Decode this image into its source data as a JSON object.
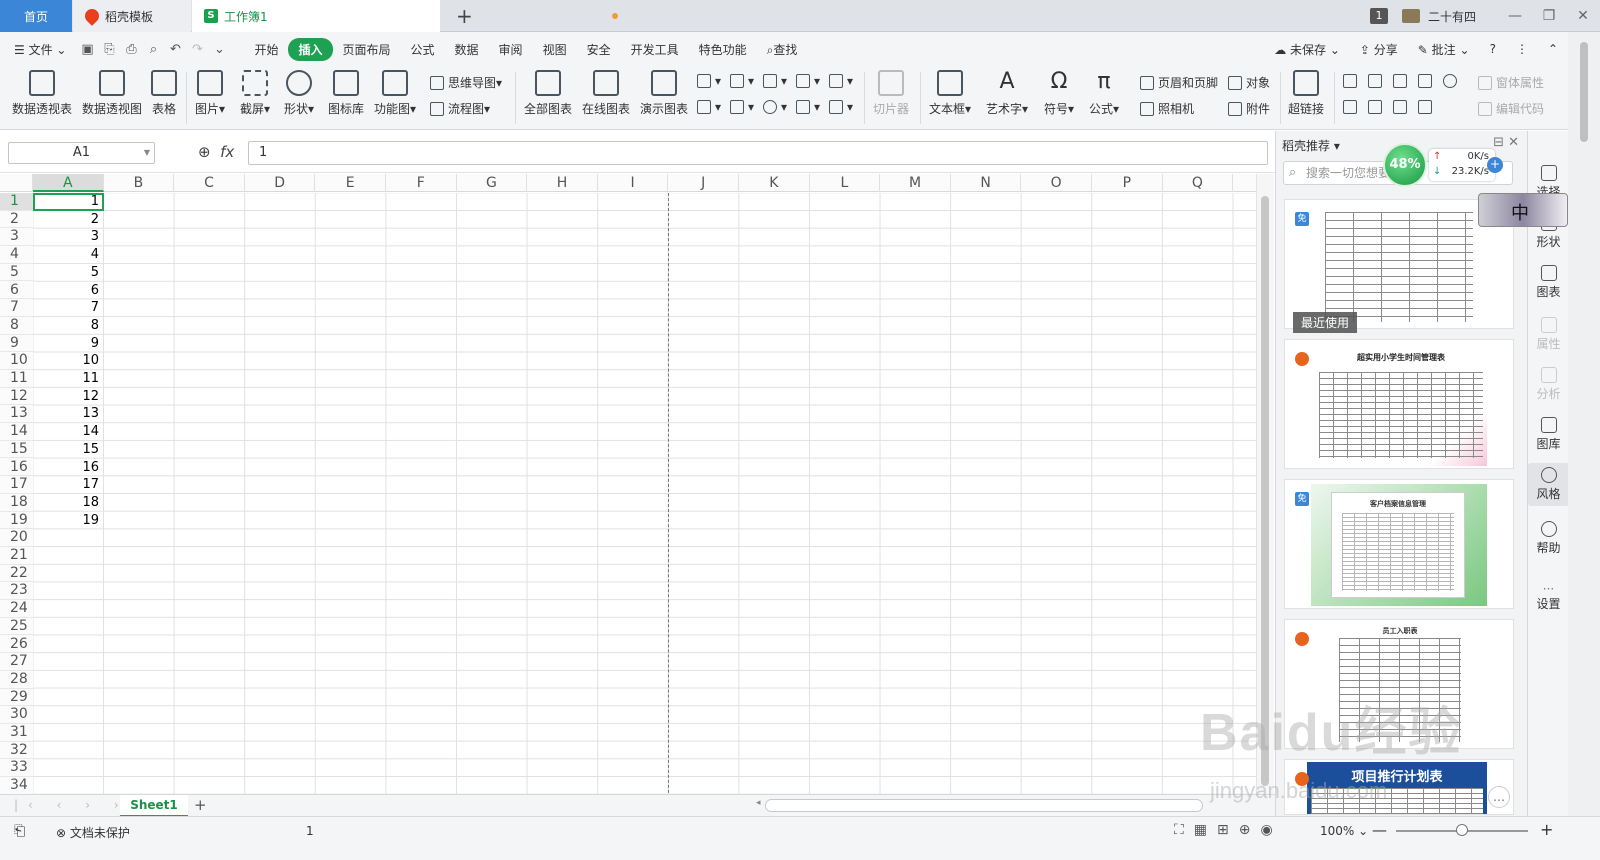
{
  "titlebar": {
    "tabs": [
      {
        "label": "首页"
      },
      {
        "label": "稻壳模板"
      },
      {
        "label": "工作簿1"
      }
    ],
    "badge": "1",
    "user_name": "二十有四",
    "window_controls": [
      "—",
      "❐",
      "✕"
    ]
  },
  "menubar": {
    "file_label": "文件",
    "items": [
      "开始",
      "插入",
      "页面布局",
      "公式",
      "数据",
      "审阅",
      "视图",
      "安全",
      "开发工具",
      "特色功能"
    ],
    "active": "插入",
    "search_label": "查找",
    "right": {
      "unsaved": "未保存",
      "share": "分享",
      "comment": "批注"
    }
  },
  "ribbon": {
    "large": [
      "数据透视表",
      "数据透视图",
      "表格",
      "图片",
      "截屏",
      "形状",
      "图标库",
      "功能图",
      "全部图表",
      "在线图表",
      "演示图表",
      "切片器",
      "文本框",
      "艺术字",
      "符号",
      "公式",
      "超链接"
    ],
    "mindmap": "思维导图",
    "flowchart": "流程图",
    "header_footer": "页眉和页脚",
    "object": "对象",
    "camera": "照相机",
    "attachment": "附件",
    "form_props": "窗体属性",
    "edit_code": "编辑代码"
  },
  "formula_bar": {
    "name_box": "A1",
    "fx": "fx",
    "value": "1"
  },
  "grid": {
    "columns": [
      "A",
      "B",
      "C",
      "D",
      "E",
      "F",
      "G",
      "H",
      "I",
      "J",
      "K",
      "L",
      "M",
      "N",
      "O",
      "P",
      "Q"
    ],
    "rows": [
      "1",
      "2",
      "3",
      "4",
      "5",
      "6",
      "7",
      "8",
      "9",
      "10",
      "11",
      "12",
      "13",
      "14",
      "15",
      "16",
      "17",
      "18",
      "19",
      "20",
      "21",
      "22",
      "23",
      "24",
      "25",
      "26",
      "27",
      "28",
      "29",
      "30",
      "31",
      "32",
      "33",
      "34"
    ],
    "column_a_values": [
      "1",
      "2",
      "3",
      "4",
      "5",
      "6",
      "7",
      "8",
      "9",
      "10",
      "11",
      "12",
      "13",
      "14",
      "15",
      "16",
      "17",
      "18",
      "19"
    ]
  },
  "sheetbar": {
    "sheet_name": "Sheet1",
    "add": "+"
  },
  "statusbar": {
    "protect": "文档未保护",
    "value": "1",
    "zoom": "100%"
  },
  "right_pane": {
    "title": "稻壳推荐",
    "search_placeholder": "搜索一切您想要",
    "free_tag": "免",
    "recent": "最近使用",
    "card2_title": "超实用小学生时间管理表",
    "card3_title": "客户档案信息管理",
    "card4_title": "员工入职表",
    "card5_title": "项目推行计划表"
  },
  "side": [
    "选择",
    "形状",
    "图表",
    "属性",
    "分析",
    "图库",
    "风格",
    "帮助",
    "设置"
  ],
  "speed_widget": {
    "percent": "48%",
    "up": "0K/s",
    "down": "23.2K/s"
  },
  "ime": {
    "label": "中"
  },
  "watermark": {
    "main": "Baidu经验",
    "sub": "jingyan.baidu.com"
  }
}
